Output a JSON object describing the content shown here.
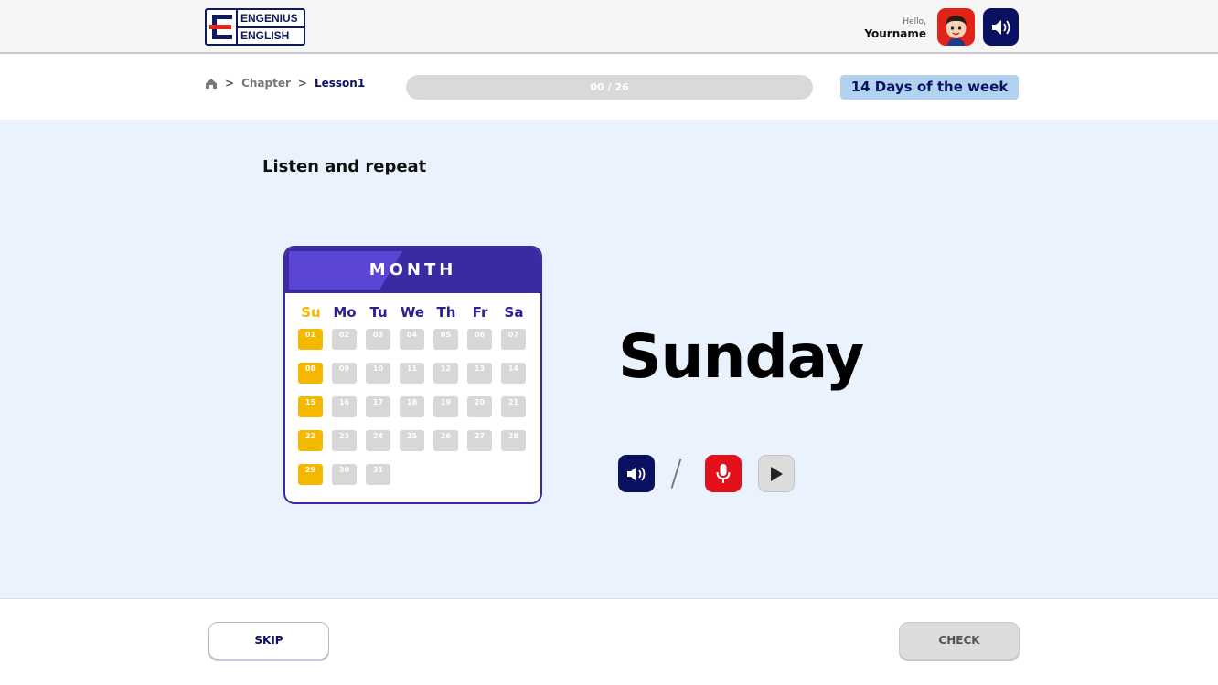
{
  "header": {
    "logo": {
      "line1": "ENGENIUS",
      "line2": "ENGLISH"
    },
    "greeting": "Hello,",
    "username": "Yourname"
  },
  "breadcrumb": {
    "chapter": "Chapter",
    "lesson": "Lesson1",
    "separator": ">"
  },
  "progress": {
    "text": "00 / 26",
    "fraction": 0
  },
  "topic": "14 Days of the week",
  "instruction": "Listen and repeat",
  "calendar": {
    "title": "MONTH",
    "weekdays": [
      "Su",
      "Mo",
      "Tu",
      "We",
      "Th",
      "Fr",
      "Sa"
    ],
    "weeks": [
      [
        "01",
        "02",
        "03",
        "04",
        "05",
        "06",
        "07"
      ],
      [
        "08",
        "09",
        "10",
        "11",
        "12",
        "13",
        "14"
      ],
      [
        "15",
        "16",
        "17",
        "18",
        "19",
        "20",
        "21"
      ],
      [
        "22",
        "23",
        "24",
        "25",
        "26",
        "27",
        "28"
      ],
      [
        "29",
        "30",
        "31"
      ]
    ]
  },
  "word": "Sunday",
  "controls": {
    "separator": "/"
  },
  "footer": {
    "skip_label": "SKIP",
    "check_label": "CHECK"
  },
  "colors": {
    "navy": "#0a1160",
    "red": "#e2231a",
    "highlight": "#f5b800",
    "background": "#eaf3fd",
    "purple": "#3a2ba3"
  }
}
